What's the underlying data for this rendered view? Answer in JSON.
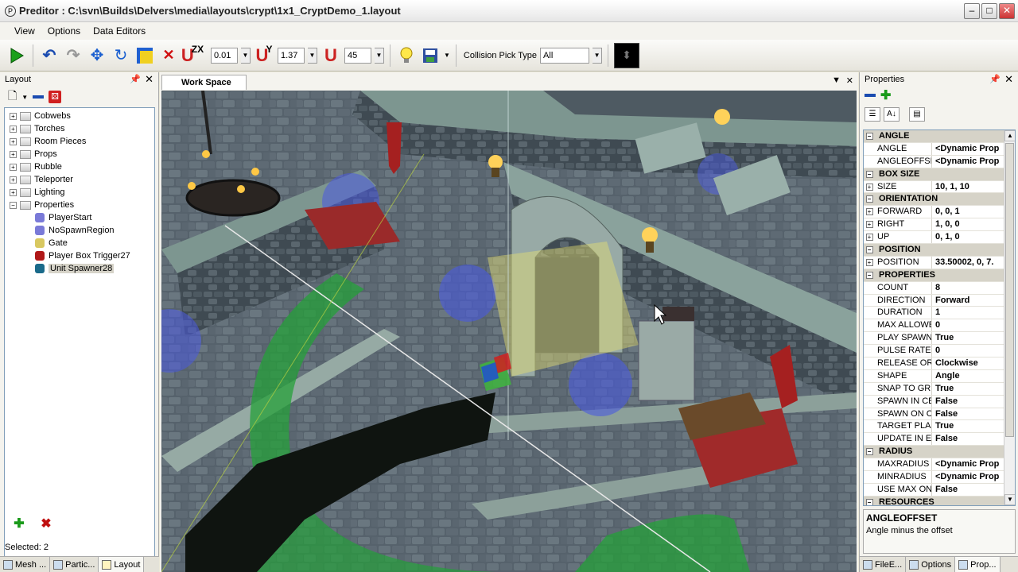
{
  "window": {
    "title": "Preditor : C:\\svn\\Builds\\Delvers\\media\\layouts\\crypt\\1x1_CryptDemo_1.layout"
  },
  "menu": [
    "View",
    "Options",
    "Data Editors"
  ],
  "toolbar": {
    "snap_zx": "ZX",
    "snap_zx_value": "0.01",
    "snap_y": "Y",
    "snap_y_value": "1.37",
    "angle_value": "45",
    "collision_label": "Collision Pick Type",
    "collision_value": "All"
  },
  "layout_panel": {
    "title": "Layout",
    "tree": [
      {
        "label": "Cobwebs",
        "type": "folder"
      },
      {
        "label": "Torches",
        "type": "folder"
      },
      {
        "label": "Room Pieces",
        "type": "folder"
      },
      {
        "label": "Props",
        "type": "folder"
      },
      {
        "label": "Rubble",
        "type": "folder"
      },
      {
        "label": "Teleporter",
        "type": "folder"
      },
      {
        "label": "Lighting",
        "type": "folder"
      },
      {
        "label": "Properties",
        "type": "folder-open"
      },
      {
        "label": "PlayerStart",
        "type": "child",
        "icon_color": "#7a7ad8"
      },
      {
        "label": "NoSpawnRegion",
        "type": "child",
        "icon_color": "#7a7ad8"
      },
      {
        "label": "Gate",
        "type": "child",
        "icon_color": "#d8c860"
      },
      {
        "label": "Player Box Trigger27",
        "type": "child",
        "icon_color": "#b01818"
      },
      {
        "label": "Unit Spawner28",
        "type": "child",
        "icon_color": "#1a6a8a"
      }
    ],
    "status": "Selected: 2",
    "tabs": [
      "Mesh ...",
      "Partic...",
      "Layout"
    ]
  },
  "workspace": {
    "tab": "Work Space"
  },
  "properties_panel": {
    "title": "Properties",
    "rows": [
      {
        "cat": "ANGLE"
      },
      {
        "name": "ANGLE",
        "value": "<Dynamic Prop"
      },
      {
        "name": "ANGLEOFFSE",
        "value": "<Dynamic Prop"
      },
      {
        "cat": "BOX SIZE"
      },
      {
        "name": "SIZE",
        "value": "10, 1, 10",
        "exp": true
      },
      {
        "cat": "ORIENTATION"
      },
      {
        "name": "FORWARD",
        "value": "0, 0, 1",
        "exp": true
      },
      {
        "name": "RIGHT",
        "value": "1, 0, 0",
        "exp": true
      },
      {
        "name": "UP",
        "value": "0, 1, 0",
        "exp": true
      },
      {
        "cat": "POSITION"
      },
      {
        "name": "POSITION",
        "value": "33.50002, 0, 7.",
        "exp": true
      },
      {
        "cat": "PROPERTIES"
      },
      {
        "name": "COUNT",
        "value": "8"
      },
      {
        "name": "DIRECTION",
        "value": "Forward"
      },
      {
        "name": "DURATION",
        "value": "1"
      },
      {
        "name": "MAX ALLOWE",
        "value": "0"
      },
      {
        "name": "PLAY SPAWN",
        "value": "True"
      },
      {
        "name": "PULSE RATE",
        "value": "0"
      },
      {
        "name": "RELEASE OR",
        "value": "Clockwise"
      },
      {
        "name": "SHAPE",
        "value": "Angle"
      },
      {
        "name": "SNAP TO GR",
        "value": "True"
      },
      {
        "name": "SPAWN IN CE",
        "value": "False"
      },
      {
        "name": "SPAWN ON C",
        "value": "False"
      },
      {
        "name": "TARGET PLA",
        "value": "True"
      },
      {
        "name": "UPDATE IN E",
        "value": "False"
      },
      {
        "cat": "RADIUS"
      },
      {
        "name": "MAXRADIUS",
        "value": "<Dynamic Prop"
      },
      {
        "name": "MINRADIUS",
        "value": "<Dynamic Prop"
      },
      {
        "name": "USE MAX ON",
        "value": "False"
      },
      {
        "cat": "RESOURCES"
      }
    ],
    "description_title": "ANGLEOFFSET",
    "description_text": "Angle minus the offset",
    "tabs": [
      "FileE...",
      "Options",
      "Prop..."
    ]
  }
}
